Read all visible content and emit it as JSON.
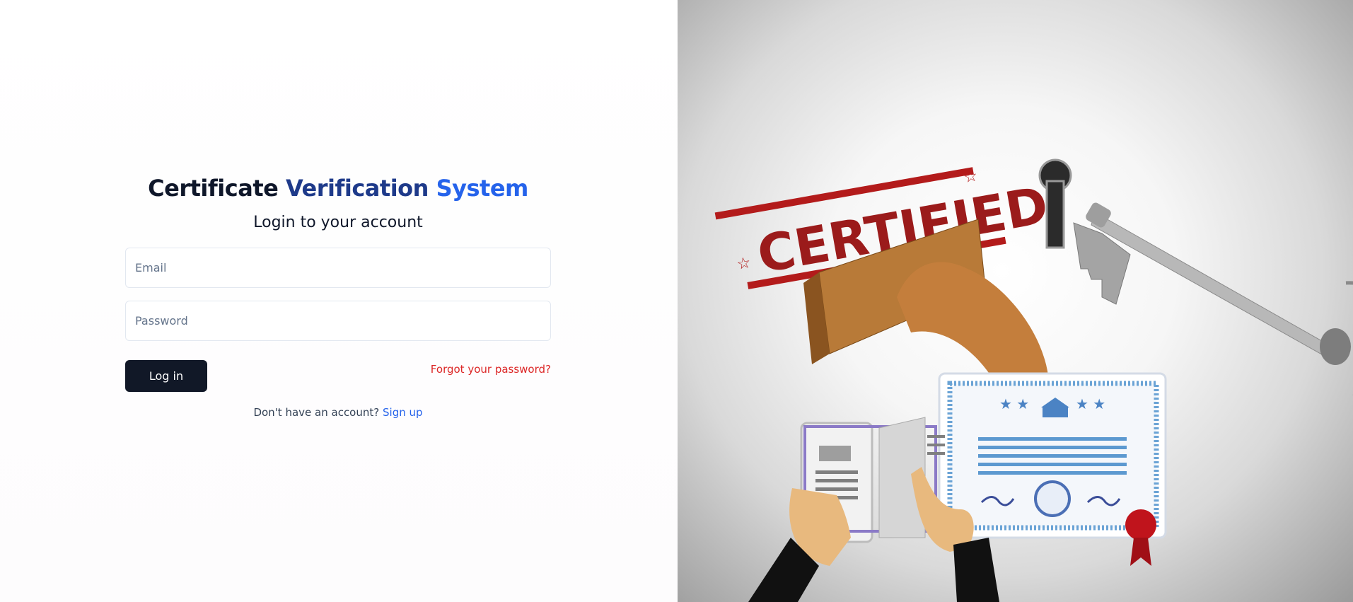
{
  "title": {
    "part1": "Certificate",
    "part2": "Verification",
    "part3": "System"
  },
  "subtitle": "Login to your account",
  "form": {
    "email_placeholder": "Email",
    "password_placeholder": "Password",
    "login_label": "Log in",
    "forgot_label": "Forgot your password?"
  },
  "signup": {
    "prompt": "Don't have an account?",
    "link_label": "Sign up"
  },
  "illustration": {
    "stamp_text": "CERTIFIED"
  },
  "colors": {
    "dark": "#0f172a",
    "navy": "#1e3a8a",
    "blue": "#2563eb",
    "danger": "#dc2626",
    "button": "#111827"
  }
}
